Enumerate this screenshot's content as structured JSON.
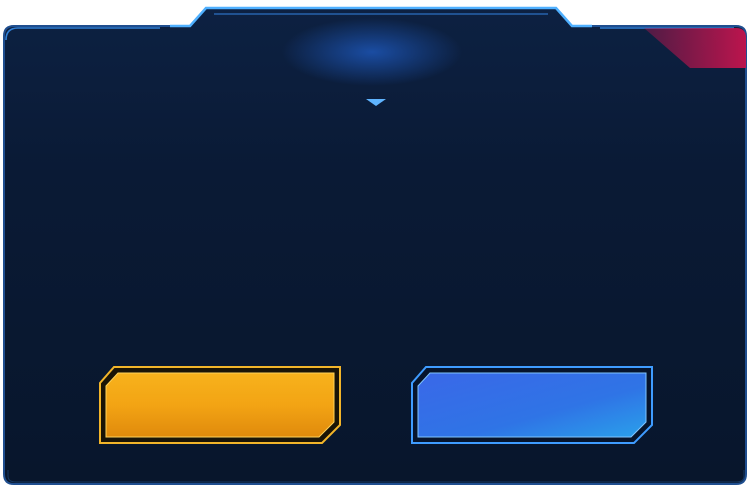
{
  "dialog": {
    "title": "",
    "message": "",
    "colors": {
      "panel": "#0a1a33",
      "border": "#2f7fd6",
      "border_bright": "#4fb0ff",
      "corner_accent": "#c5144e"
    }
  },
  "buttons": {
    "confirm_label": "",
    "cancel_label": "",
    "confirm_color": "#f3a414",
    "cancel_color": "#2f74e6"
  }
}
